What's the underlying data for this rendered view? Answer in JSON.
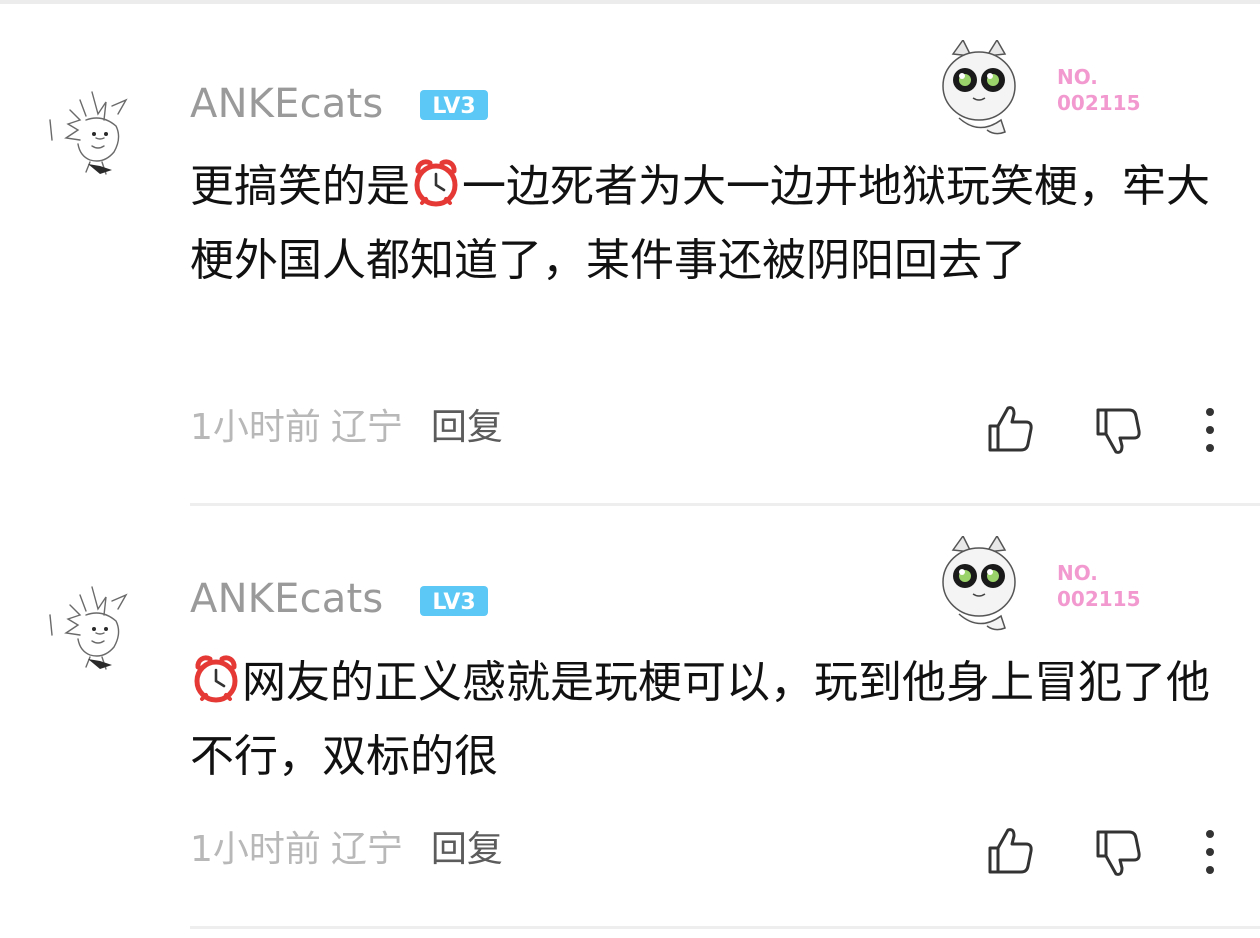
{
  "comments": [
    {
      "username": "ANKEcats",
      "level_badge": "LV3",
      "pendant_label_line1": "NO.",
      "pendant_label_line2": "002115",
      "text_before_icon": "更搞笑的是",
      "inline_icon": "alarm-clock-emoji",
      "text_after_icon": "一边死者为大一边开地狱玩笑梗，牢大梗外国人都知道了，某件事还被阴阳回去了",
      "time": "1小时前",
      "location": "辽宁",
      "reply_label": "回复"
    },
    {
      "username": "ANKEcats",
      "level_badge": "LV3",
      "pendant_label_line1": "NO.",
      "pendant_label_line2": "002115",
      "text_before_icon": "",
      "inline_icon": "alarm-clock-emoji",
      "text_after_icon": "网友的正义感就是玩梗可以，玩到他身上冒犯了他不行，双标的很",
      "time": "1小时前",
      "location": "辽宁",
      "reply_label": "回复"
    }
  ],
  "icons": {
    "like": "thumbs-up-icon",
    "dislike": "thumbs-down-icon",
    "more": "more-vertical-icon"
  },
  "colors": {
    "username": "#9a9a9a",
    "level_badge": "#5bc8f5",
    "pendant_label": "#f29ad0",
    "meta": "#b8b8b8",
    "reply": "#5c5c5c",
    "alarm_clock": "#e53935"
  }
}
